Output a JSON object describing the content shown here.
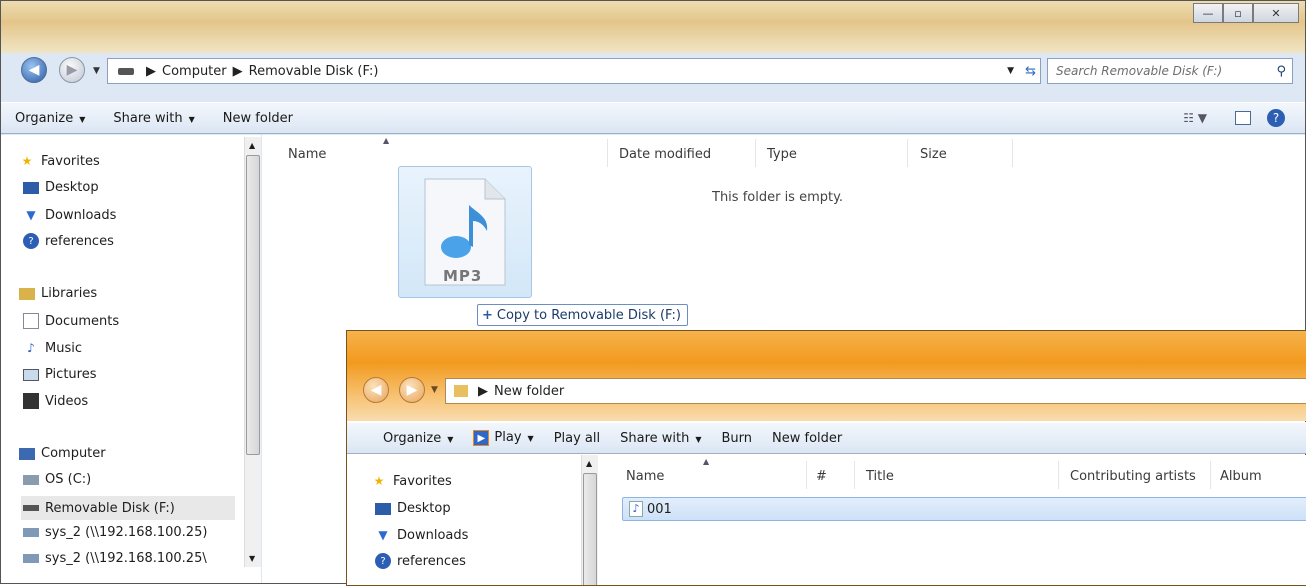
{
  "back_window": {
    "caption_buttons": {
      "minimize": "—",
      "maximize": "▫",
      "close": "✕"
    },
    "breadcrumb": [
      "Computer",
      "Removable Disk (F:)"
    ],
    "search_placeholder": "Search Removable Disk (F:)",
    "toolbar": {
      "organize": "Organize",
      "share_with": "Share with",
      "new_folder": "New folder"
    },
    "nav": {
      "favorites": "Favorites",
      "favorite_items": [
        "Desktop",
        "Downloads",
        "references"
      ],
      "libraries": "Libraries",
      "library_items": [
        "Documents",
        "Music",
        "Pictures",
        "Videos"
      ],
      "computer": "Computer",
      "computer_items": [
        "OS (C:)",
        "Removable Disk (F:)",
        "sys_2 (\\\\192.168.100.25)",
        "sys_2 (\\\\192.168.100.25\\"
      ]
    },
    "columns": [
      "Name",
      "Date modified",
      "Type",
      "Size"
    ],
    "empty_message": "This folder is empty.",
    "drag_icon_label": "MP3",
    "drag_tooltip": "Copy to Removable Disk (F:)"
  },
  "front_window": {
    "breadcrumb": [
      "New folder"
    ],
    "toolbar": {
      "organize": "Organize",
      "play": "Play",
      "play_all": "Play all",
      "share_with": "Share with",
      "burn": "Burn",
      "new_folder": "New folder"
    },
    "nav": {
      "favorites": "Favorites",
      "favorite_items": [
        "Desktop",
        "Downloads",
        "references"
      ]
    },
    "columns": [
      "Name",
      "#",
      "Title",
      "Contributing artists",
      "Album"
    ],
    "files": [
      {
        "name": "001"
      }
    ]
  },
  "colors": {
    "accent_blue": "#2b5aa3",
    "active_title": "#f29a1e",
    "selection": "#cde1f7"
  }
}
